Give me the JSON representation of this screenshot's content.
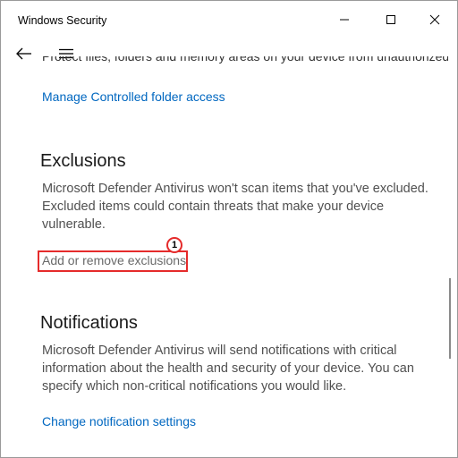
{
  "window": {
    "title": "Windows Security"
  },
  "nav": {
    "back_icon": "back-arrow-icon",
    "menu_icon": "hamburger-menu-icon"
  },
  "partial_text": "Protect files, folders and memory areas on your device from unauthorized changes by unfriendly apps",
  "controlled_folder": {
    "link": "Manage Controlled folder access"
  },
  "exclusions": {
    "title": "Exclusions",
    "description": "Microsoft Defender Antivirus won't scan items that you've excluded. Excluded items could contain threats that make your device vulnerable.",
    "link": "Add or remove exclusions",
    "callout_number": "1"
  },
  "notifications": {
    "title": "Notifications",
    "description": "Microsoft Defender Antivirus will send notifications with critical information about the health and security of your device. You can specify which non-critical notifications you would like.",
    "link": "Change notification settings"
  },
  "colors": {
    "link": "#0067c0",
    "highlight": "#e52b2b"
  }
}
